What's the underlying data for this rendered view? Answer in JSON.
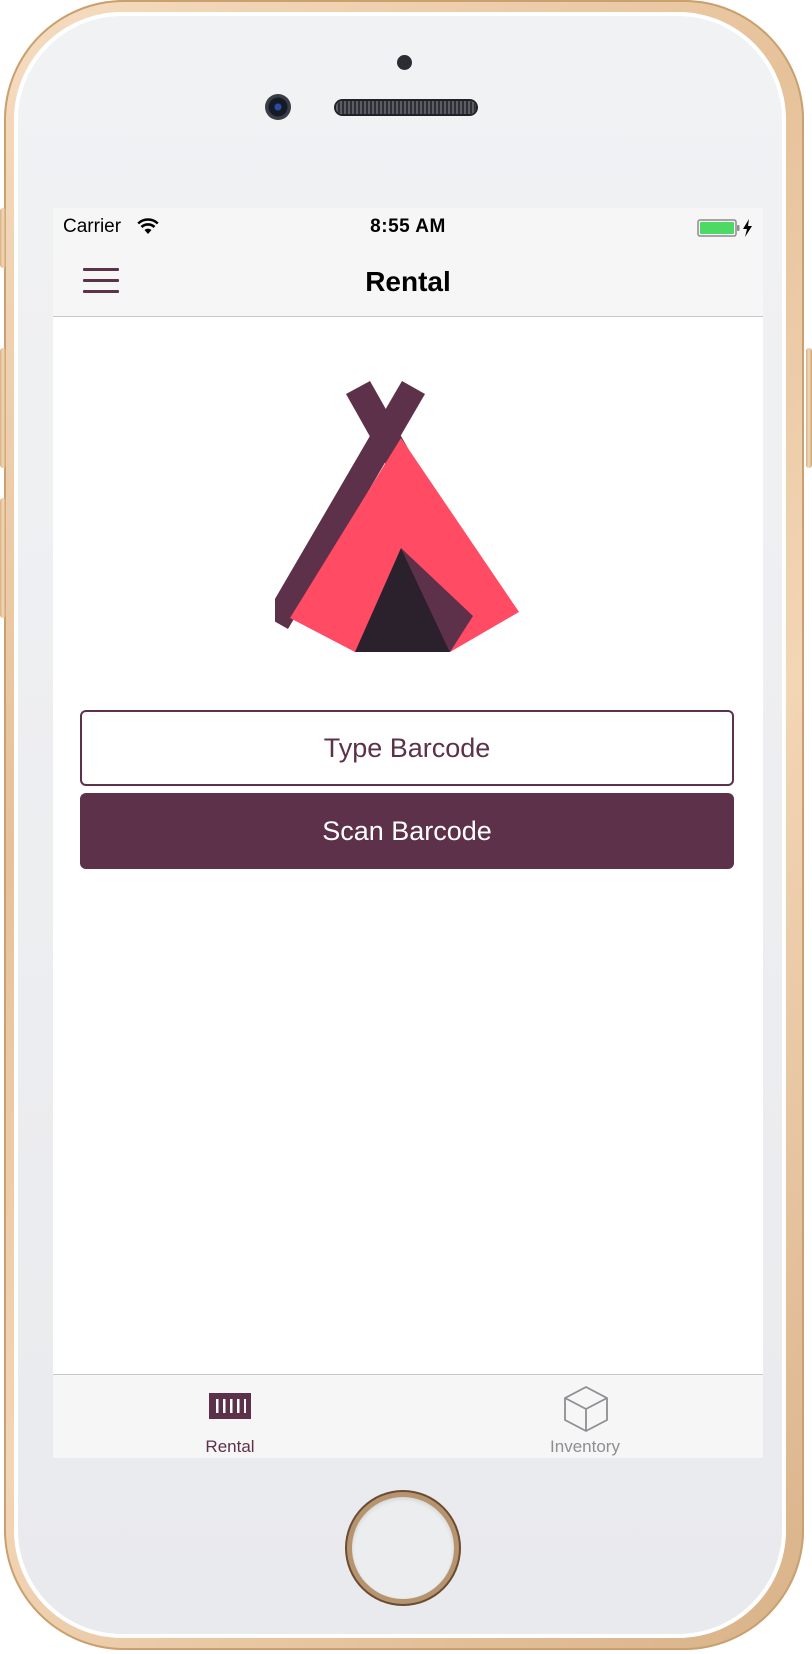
{
  "status_bar": {
    "carrier": "Carrier",
    "time": "8:55 AM",
    "wifi_icon": "wifi-icon",
    "battery_icon": "battery-charging-icon",
    "battery_color": "#4cd964"
  },
  "nav": {
    "title": "Rental",
    "menu_icon": "hamburger-menu-icon"
  },
  "logo": {
    "icon": "tent-icon",
    "colors": {
      "pole": "#5d3149",
      "canvas": "#ff4b63",
      "door": "#2a212c",
      "flap": "#5d3149"
    }
  },
  "buttons": {
    "type_barcode": "Type Barcode",
    "scan_barcode": "Scan Barcode"
  },
  "tabs": [
    {
      "label": "Rental",
      "icon": "barcode-icon",
      "active": true
    },
    {
      "label": "Inventory",
      "icon": "box-icon",
      "active": false
    }
  ],
  "theme": {
    "accent": "#5d3149",
    "inactive": "#8e8e93"
  }
}
